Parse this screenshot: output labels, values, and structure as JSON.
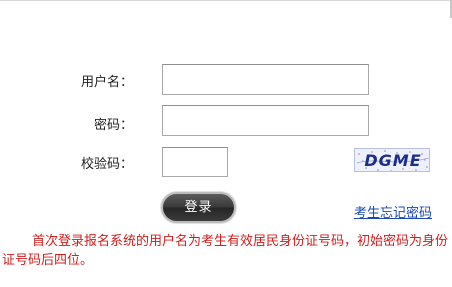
{
  "form": {
    "username_label": "用户名：",
    "password_label": "密码：",
    "captcha_label": "校验码：",
    "username_value": "",
    "password_value": "",
    "captcha_value": ""
  },
  "captcha_image": {
    "text": "DGME"
  },
  "actions": {
    "login_label": "登录",
    "forgot_password_label": "考生忘记密码"
  },
  "notice": {
    "text": "首次登录报名系统的用户名为考生有效居民身份证号码，初始密码为身份证号码后四位。",
    "color": "#cc1f1f"
  },
  "colors": {
    "link": "#1a49b3",
    "button": "#3a3a3a",
    "captcha_text": "#1d2e8a"
  }
}
